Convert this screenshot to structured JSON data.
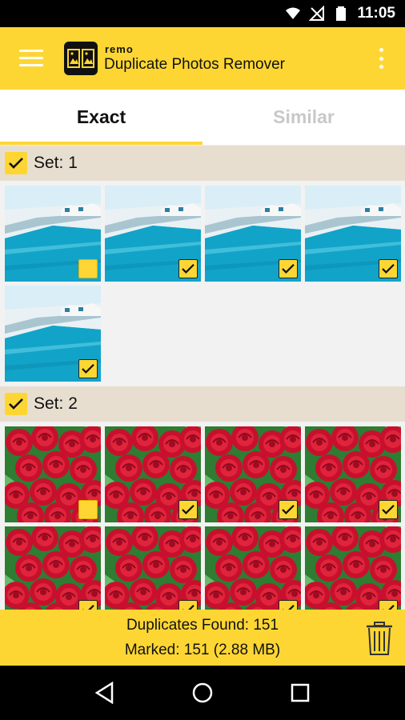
{
  "status_bar": {
    "time": "11:05"
  },
  "app_bar": {
    "brand": "remo",
    "title": "Duplicate Photos Remover"
  },
  "tabs": [
    {
      "label": "Exact",
      "active": true
    },
    {
      "label": "Similar",
      "active": false
    }
  ],
  "sets": [
    {
      "label": "Set: 1",
      "checked": true,
      "image": "sea-resort-photo",
      "photos_checked": [
        false,
        true,
        true,
        true,
        true
      ]
    },
    {
      "label": "Set: 2",
      "checked": true,
      "image": "red-roses-photo",
      "photos_checked": [
        false,
        true,
        true,
        true,
        true,
        true,
        true,
        true
      ]
    }
  ],
  "bottom_bar": {
    "duplicates_found": "Duplicates Found: 151",
    "marked": "Marked: 151 (2.88 MB)"
  },
  "colors": {
    "accent": "#fdd634",
    "set_header_bg": "#e8ded0"
  }
}
